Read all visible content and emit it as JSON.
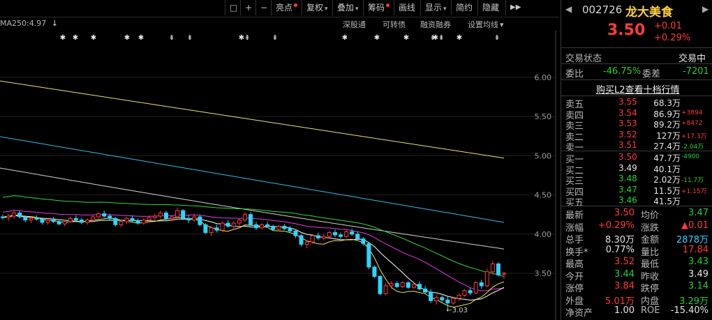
{
  "toolbar": {
    "buttons": [
      {
        "label": "□",
        "name": "window-icon"
      },
      {
        "label": "+",
        "name": "zoom-in-icon"
      },
      {
        "label": "−",
        "name": "zoom-out-icon"
      },
      {
        "label": "亮点",
        "dot": true
      },
      {
        "label": "复权",
        "caret": true
      },
      {
        "label": "叠加",
        "caret": true
      },
      {
        "label": "筹码",
        "dot": true
      },
      {
        "label": "画线"
      },
      {
        "label": "显示",
        "caret": true
      },
      {
        "label": "简约"
      },
      {
        "label": "隐藏"
      }
    ],
    "more": "▶▶"
  },
  "info": {
    "ma250": "MA250:4.97",
    "arrow": "↓",
    "links": [
      "深股通",
      "可转债",
      "融资融券",
      "设置均线"
    ],
    "caret": "▾"
  },
  "chart_data": {
    "type": "candlestick",
    "y_ticks": [
      "6.00",
      "5.50",
      "5.00",
      "4.50",
      "4.00",
      "3.50"
    ],
    "ylim": [
      3.03,
      6.0
    ],
    "min_label": "3.03",
    "markers": [
      "✱",
      "✱",
      "✱",
      "✱",
      "✱",
      "⇟",
      "⇟",
      "✱⇟",
      "⇟",
      "✱",
      "✱",
      "✱",
      "⇟",
      "✱⇟",
      "✱",
      "⇟"
    ],
    "candles": [
      [
        4.22,
        4.25,
        4.18,
        4.21
      ],
      [
        4.21,
        4.26,
        4.17,
        4.23
      ],
      [
        4.23,
        4.3,
        4.2,
        4.27
      ],
      [
        4.27,
        4.3,
        4.2,
        4.22
      ],
      [
        4.22,
        4.24,
        4.15,
        4.18
      ],
      [
        4.18,
        4.22,
        4.14,
        4.2
      ],
      [
        4.2,
        4.24,
        4.17,
        4.19
      ],
      [
        4.19,
        4.21,
        4.12,
        4.15
      ],
      [
        4.15,
        4.2,
        4.12,
        4.18
      ],
      [
        4.18,
        4.22,
        4.14,
        4.16
      ],
      [
        4.16,
        4.19,
        4.11,
        4.13
      ],
      [
        4.13,
        4.18,
        4.1,
        4.16
      ],
      [
        4.16,
        4.22,
        4.14,
        4.2
      ],
      [
        4.2,
        4.24,
        4.16,
        4.18
      ],
      [
        4.18,
        4.21,
        4.13,
        4.15
      ],
      [
        4.15,
        4.2,
        4.12,
        4.18
      ],
      [
        4.18,
        4.24,
        4.16,
        4.22
      ],
      [
        4.22,
        4.28,
        4.2,
        4.26
      ],
      [
        4.26,
        4.3,
        4.21,
        4.23
      ],
      [
        4.23,
        4.26,
        4.18,
        4.2
      ],
      [
        4.2,
        4.22,
        4.1,
        4.12
      ],
      [
        4.12,
        4.18,
        4.09,
        4.16
      ],
      [
        4.16,
        4.22,
        4.13,
        4.2
      ],
      [
        4.2,
        4.24,
        4.15,
        4.17
      ],
      [
        4.17,
        4.2,
        4.12,
        4.14
      ],
      [
        4.14,
        4.2,
        4.12,
        4.18
      ],
      [
        4.18,
        4.24,
        4.16,
        4.21
      ],
      [
        4.21,
        4.26,
        4.18,
        4.23
      ],
      [
        4.23,
        4.3,
        4.2,
        4.27
      ],
      [
        4.27,
        4.3,
        4.18,
        4.2
      ],
      [
        4.2,
        4.24,
        4.16,
        4.22
      ],
      [
        4.22,
        4.34,
        4.2,
        4.3
      ],
      [
        4.3,
        4.32,
        4.18,
        4.2
      ],
      [
        4.2,
        4.24,
        4.14,
        4.18
      ],
      [
        4.18,
        4.26,
        4.16,
        4.22
      ],
      [
        4.22,
        4.25,
        4.1,
        4.12
      ],
      [
        4.12,
        4.14,
        4.0,
        4.02
      ],
      [
        4.02,
        4.1,
        3.98,
        4.08
      ],
      [
        4.08,
        4.12,
        4.02,
        4.05
      ],
      [
        4.05,
        4.16,
        4.03,
        4.14
      ],
      [
        4.14,
        4.18,
        4.08,
        4.1
      ],
      [
        4.1,
        4.16,
        4.07,
        4.14
      ],
      [
        4.14,
        4.2,
        4.11,
        4.18
      ],
      [
        4.18,
        4.28,
        4.16,
        4.25
      ],
      [
        4.25,
        4.28,
        4.1,
        4.12
      ],
      [
        4.12,
        4.16,
        4.05,
        4.08
      ],
      [
        4.08,
        4.14,
        4.06,
        4.12
      ],
      [
        4.12,
        4.16,
        4.08,
        4.1
      ],
      [
        4.1,
        4.12,
        4.04,
        4.06
      ],
      [
        4.06,
        4.12,
        4.04,
        4.1
      ],
      [
        4.1,
        4.13,
        4.05,
        4.07
      ],
      [
        4.07,
        4.1,
        4.02,
        4.04
      ],
      [
        4.04,
        4.06,
        3.95,
        3.98
      ],
      [
        3.98,
        4.0,
        3.84,
        3.87
      ],
      [
        3.87,
        3.92,
        3.82,
        3.9
      ],
      [
        3.9,
        4.0,
        3.88,
        3.98
      ],
      [
        3.98,
        4.02,
        3.92,
        3.95
      ],
      [
        3.95,
        4.0,
        3.92,
        3.97
      ],
      [
        3.97,
        4.04,
        3.95,
        4.02
      ],
      [
        4.02,
        4.06,
        3.96,
        3.99
      ],
      [
        3.99,
        4.02,
        3.94,
        3.97
      ],
      [
        3.97,
        4.05,
        3.95,
        4.03
      ],
      [
        4.03,
        4.07,
        3.98,
        4.0
      ],
      [
        4.0,
        4.03,
        3.92,
        3.94
      ],
      [
        3.94,
        3.96,
        3.85,
        3.88
      ],
      [
        3.88,
        3.9,
        3.55,
        3.58
      ],
      [
        3.58,
        3.6,
        3.44,
        3.46
      ],
      [
        3.46,
        3.48,
        3.22,
        3.24
      ],
      [
        3.24,
        3.38,
        3.22,
        3.34
      ],
      [
        3.34,
        3.4,
        3.3,
        3.37
      ],
      [
        3.37,
        3.4,
        3.31,
        3.33
      ],
      [
        3.33,
        3.4,
        3.31,
        3.38
      ],
      [
        3.38,
        3.4,
        3.3,
        3.32
      ],
      [
        3.32,
        3.38,
        3.3,
        3.36
      ],
      [
        3.36,
        3.4,
        3.28,
        3.3
      ],
      [
        3.3,
        3.34,
        3.24,
        3.26
      ],
      [
        3.26,
        3.3,
        3.12,
        3.15
      ],
      [
        3.15,
        3.22,
        3.1,
        3.19
      ],
      [
        3.19,
        3.22,
        3.13,
        3.16
      ],
      [
        3.16,
        3.2,
        3.03,
        3.12
      ],
      [
        3.12,
        3.2,
        3.1,
        3.18
      ],
      [
        3.18,
        3.24,
        3.15,
        3.22
      ],
      [
        3.22,
        3.3,
        3.2,
        3.28
      ],
      [
        3.28,
        3.32,
        3.22,
        3.25
      ],
      [
        3.25,
        3.4,
        3.23,
        3.38
      ],
      [
        3.38,
        3.42,
        3.3,
        3.34
      ],
      [
        3.34,
        3.56,
        3.32,
        3.52
      ],
      [
        3.52,
        3.66,
        3.48,
        3.62
      ],
      [
        3.62,
        3.64,
        3.46,
        3.48
      ],
      [
        3.49,
        3.52,
        3.43,
        3.5
      ]
    ],
    "ma": [
      {
        "name": "MA250",
        "color": "#e6e07a",
        "from": 5.96,
        "to": 4.97
      },
      {
        "name": "MA120",
        "color": "#3bb7e6",
        "from": 5.25,
        "to": 4.15
      },
      {
        "name": "MA60",
        "color": "#d0d0d0",
        "from": 4.85,
        "to": 3.81
      },
      {
        "name": "MA30",
        "color": "#39d640",
        "from": 4.47,
        "to": 3.46
      },
      {
        "name": "MA20",
        "color": "#e63be6",
        "from": 4.28,
        "to": 3.31
      },
      {
        "name": "MA10",
        "color": "#ffffff",
        "from": 4.21,
        "to": 3.32
      },
      {
        "name": "MA5",
        "color": "#f2e15a",
        "from": 4.22,
        "to": 3.39
      }
    ]
  },
  "panel": {
    "code": "002726",
    "name": "龙大美食",
    "price": "3.50",
    "change": "+0.01",
    "change_pct": "+0.29%",
    "status_label": "交易状态",
    "status_value": "交易中",
    "webi_label": "委比",
    "webi_value": "-46.75%",
    "weicha_label": "委差",
    "weicha_value": "-7201",
    "l2_link": "购买L2查看十档行情",
    "asks": [
      {
        "label": "卖五",
        "price": "3.55",
        "vol": "68.3万",
        "delta": ""
      },
      {
        "label": "卖四",
        "price": "3.54",
        "vol": "86.9万",
        "delta": "+3894"
      },
      {
        "label": "卖三",
        "price": "3.53",
        "vol": "89.2万",
        "delta": "+8472"
      },
      {
        "label": "卖二",
        "price": "3.52",
        "vol": "127万",
        "delta": "+17.3万"
      },
      {
        "label": "卖一",
        "price": "3.51",
        "vol": "27.4万",
        "delta": "-2.04万"
      }
    ],
    "bids": [
      {
        "label": "买一",
        "price": "3.50",
        "vol": "47.7万",
        "delta": "-4900"
      },
      {
        "label": "买二",
        "price": "3.49",
        "vol": "40.1万",
        "delta": ""
      },
      {
        "label": "买三",
        "price": "3.48",
        "vol": "2.02万",
        "delta": "-11.7万"
      },
      {
        "label": "买四",
        "price": "3.47",
        "vol": "11.5万",
        "delta": "+1.15万"
      },
      {
        "label": "买五",
        "price": "3.46",
        "vol": "41.5万",
        "delta": ""
      }
    ],
    "quotes": [
      {
        "l1": "最新",
        "v1": "3.50",
        "c1": "red",
        "l2": "均价",
        "v2": "3.47",
        "c2": "green"
      },
      {
        "l1": "涨幅",
        "v1": "+0.29%",
        "c1": "red",
        "l2": "涨跌",
        "v2": "▲0.01",
        "c2": "red"
      },
      {
        "l1": "总手",
        "v1": "8.30万",
        "c1": "white",
        "l2": "金额",
        "v2": "2878万",
        "c2": "cyan"
      },
      {
        "l1": "换手*",
        "v1": "0.77%",
        "c1": "white",
        "l2": "量比",
        "v2": "17.84",
        "c2": "red"
      },
      {
        "l1": "最高",
        "v1": "3.52",
        "c1": "red",
        "l2": "最低",
        "v2": "3.43",
        "c2": "green"
      },
      {
        "l1": "今开",
        "v1": "3.44",
        "c1": "green",
        "l2": "昨收",
        "v2": "3.49",
        "c2": "white"
      },
      {
        "l1": "涨停",
        "v1": "3.84",
        "c1": "red",
        "l2": "跌停",
        "v2": "3.14",
        "c2": "green"
      },
      {
        "l1": "外盘",
        "v1": "5.01万",
        "c1": "red",
        "l2": "内盘",
        "v2": "3.29万",
        "c2": "green"
      },
      {
        "l1": "净资产",
        "v1": "1.00",
        "c1": "white",
        "l2": "ROE",
        "v2": "-15.40%",
        "c2": "white"
      }
    ],
    "colors": {
      "up": "#ff3b3b",
      "down": "#22d13a",
      "accent": "#ffd23a"
    }
  }
}
